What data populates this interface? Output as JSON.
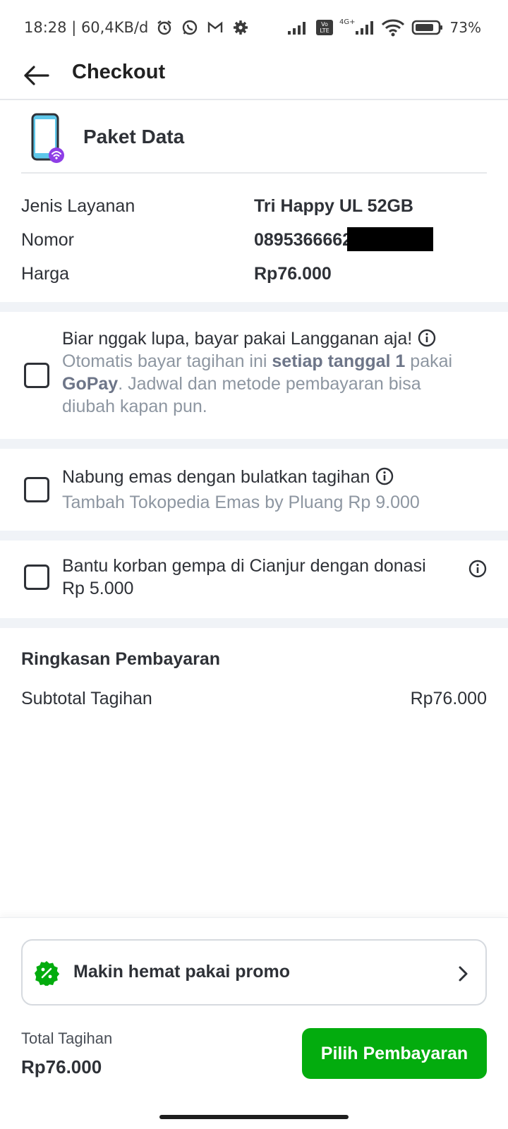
{
  "status_bar": {
    "time_and_speed": "18:28 | 60,4KB/d",
    "battery": "73%",
    "volte": "Vo LTE",
    "net_type": "4G+",
    "icons": [
      "alarm-icon",
      "whatsapp-icon",
      "gmail-icon",
      "settings-icon",
      "signal-icon",
      "wifi-icon",
      "battery-icon"
    ]
  },
  "header": {
    "title": "Checkout",
    "back_icon": "arrow-left-icon"
  },
  "product": {
    "title": "Paket Data",
    "icon": "phone-wifi-icon"
  },
  "details": [
    {
      "label": "Jenis Layanan",
      "value": "Tri Happy UL 52GB"
    },
    {
      "label": "Nomor",
      "value": "08953666626"
    },
    {
      "label": "Harga",
      "value": "Rp76.000"
    }
  ],
  "options": {
    "subscription": {
      "title": "Biar nggak lupa, bayar pakai Langganan aja!",
      "sub_1": "Otomatis bayar tagihan ini ",
      "sub_bold_1": "setiap tanggal 1",
      "sub_2": " pakai ",
      "sub_bold_2": "GoPay",
      "sub_3": ". Jadwal dan metode pembayaran bisa diubah kapan pun.",
      "checked": false
    },
    "gold": {
      "title": "Nabung emas dengan bulatkan tagihan",
      "subtitle": "Tambah Tokopedia Emas by Pluang Rp 9.000",
      "checked": false
    },
    "donation": {
      "title": "Bantu korban gempa di Cianjur dengan donasi Rp 5.000",
      "checked": false
    }
  },
  "summary": {
    "title": "Ringkasan Pembayaran",
    "subtotal_label": "Subtotal Tagihan",
    "subtotal_value": "Rp76.000"
  },
  "bottom": {
    "promo_text": "Makin hemat pakai promo",
    "total_label": "Total Tagihan",
    "total_value": "Rp76.000",
    "pay_button": "Pilih Pembayaran"
  },
  "colors": {
    "primary_green": "#03ac0e",
    "text_dark": "#2e3137",
    "text_muted": "#8d96a1",
    "separator": "#f0f3f7",
    "accent_purple": "#8e3ee6",
    "phone_blue": "#5ec7ea"
  }
}
